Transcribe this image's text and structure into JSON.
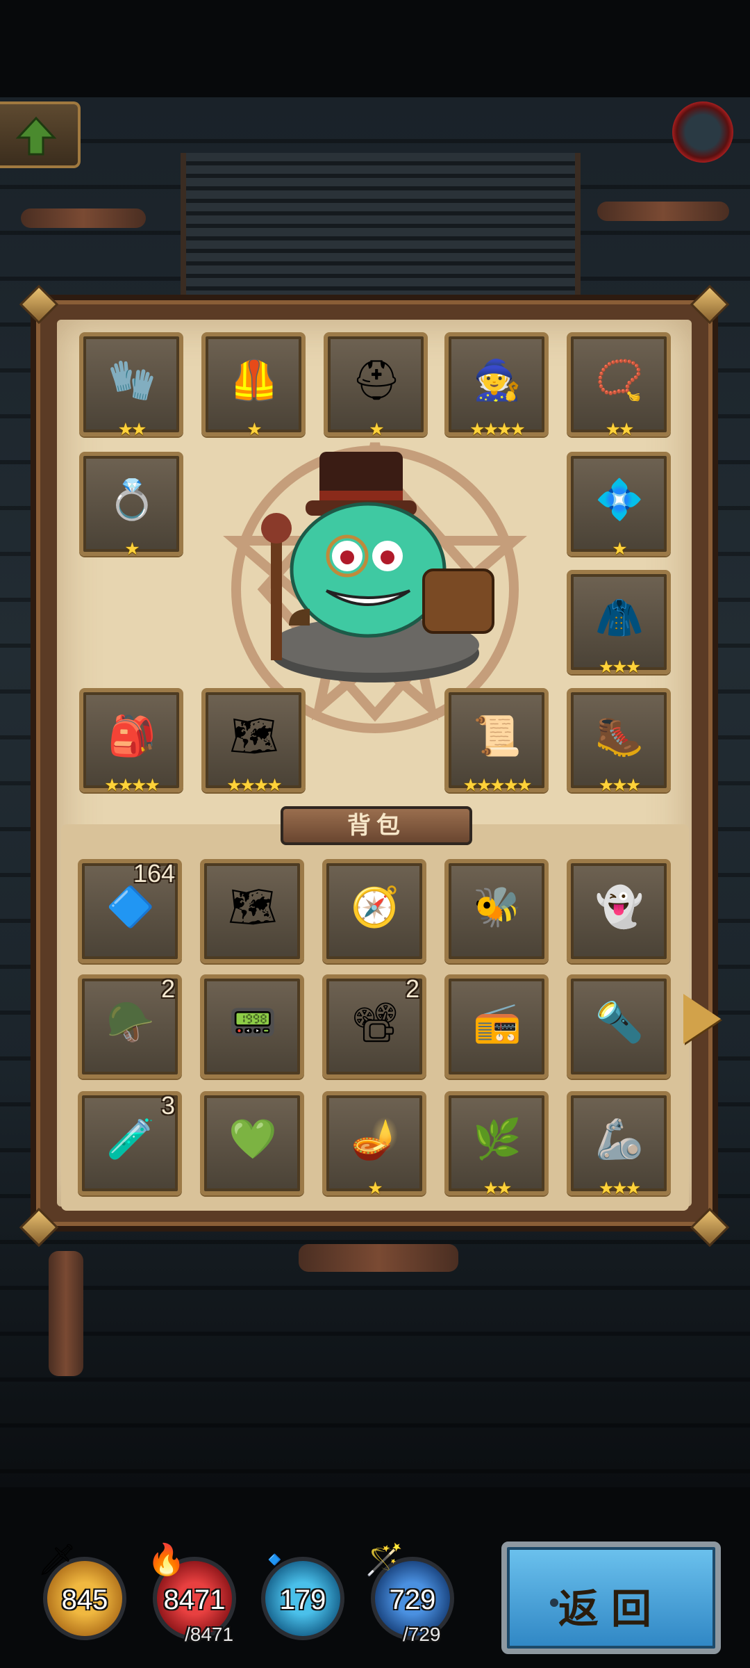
{
  "equipment": [
    {
      "name": "gauntlets",
      "icon": "🧤",
      "stars": "★★"
    },
    {
      "name": "armor",
      "icon": "🦺",
      "stars": "★"
    },
    {
      "name": "helmet",
      "icon": "⛑",
      "stars": "★"
    },
    {
      "name": "witch-hat",
      "icon": "🧙",
      "stars": "★★★★"
    },
    {
      "name": "amulet",
      "icon": "📿",
      "stars": "★★"
    },
    {
      "name": "ring",
      "icon": "💍",
      "stars": "★"
    },
    {
      "name": "sapphire-ring",
      "icon": "💠",
      "stars": "★"
    },
    {
      "name": "cloak",
      "icon": "🧥",
      "stars": "★★★"
    },
    {
      "name": "backpack",
      "icon": "🎒",
      "stars": "★★★★"
    },
    {
      "name": "map",
      "icon": "🗺",
      "stars": "★★★★"
    },
    {
      "name": "scroll",
      "icon": "📜",
      "stars": "★★★★★"
    },
    {
      "name": "boots",
      "icon": "🥾",
      "stars": "★★★"
    }
  ],
  "bag": {
    "title": "背包",
    "items": [
      {
        "name": "crystal",
        "icon": "🔷",
        "count": "164",
        "stars": ""
      },
      {
        "name": "treasure-map",
        "icon": "🗺",
        "count": "",
        "stars": ""
      },
      {
        "name": "compass",
        "icon": "🧭",
        "count": "",
        "stars": ""
      },
      {
        "name": "beehive",
        "icon": "🐝",
        "count": "",
        "stars": ""
      },
      {
        "name": "ghost",
        "icon": "👻",
        "count": "",
        "stars": ""
      },
      {
        "name": "drill-helmet",
        "icon": "🪖",
        "count": "2",
        "stars": ""
      },
      {
        "name": "device",
        "icon": "📟",
        "count": "",
        "stars": ""
      },
      {
        "name": "projector",
        "icon": "📽",
        "count": "2",
        "stars": ""
      },
      {
        "name": "radio",
        "icon": "📻",
        "count": "",
        "stars": ""
      },
      {
        "name": "capsule",
        "icon": "🔦",
        "count": "",
        "stars": ""
      },
      {
        "name": "potion",
        "icon": "🧪",
        "count": "3",
        "stars": ""
      },
      {
        "name": "emerald",
        "icon": "💚",
        "count": "",
        "stars": ""
      },
      {
        "name": "magic-lamp",
        "icon": "🪔",
        "count": "",
        "stars": "★"
      },
      {
        "name": "plant-boots",
        "icon": "🌿",
        "count": "",
        "stars": "★★"
      },
      {
        "name": "claw",
        "icon": "🦾",
        "count": "",
        "stars": "★★★"
      }
    ]
  },
  "stats": [
    {
      "name": "attack",
      "value": "845",
      "max": "",
      "color": "#c8881e"
    },
    {
      "name": "health",
      "value": "8471",
      "max": "/8471",
      "color": "#c0262a"
    },
    {
      "name": "defense",
      "value": "179",
      "max": "",
      "color": "#1f8ac0"
    },
    {
      "name": "mana",
      "value": "729",
      "max": "/729",
      "color": "#2a6ab8"
    }
  ],
  "back_label": "返回"
}
